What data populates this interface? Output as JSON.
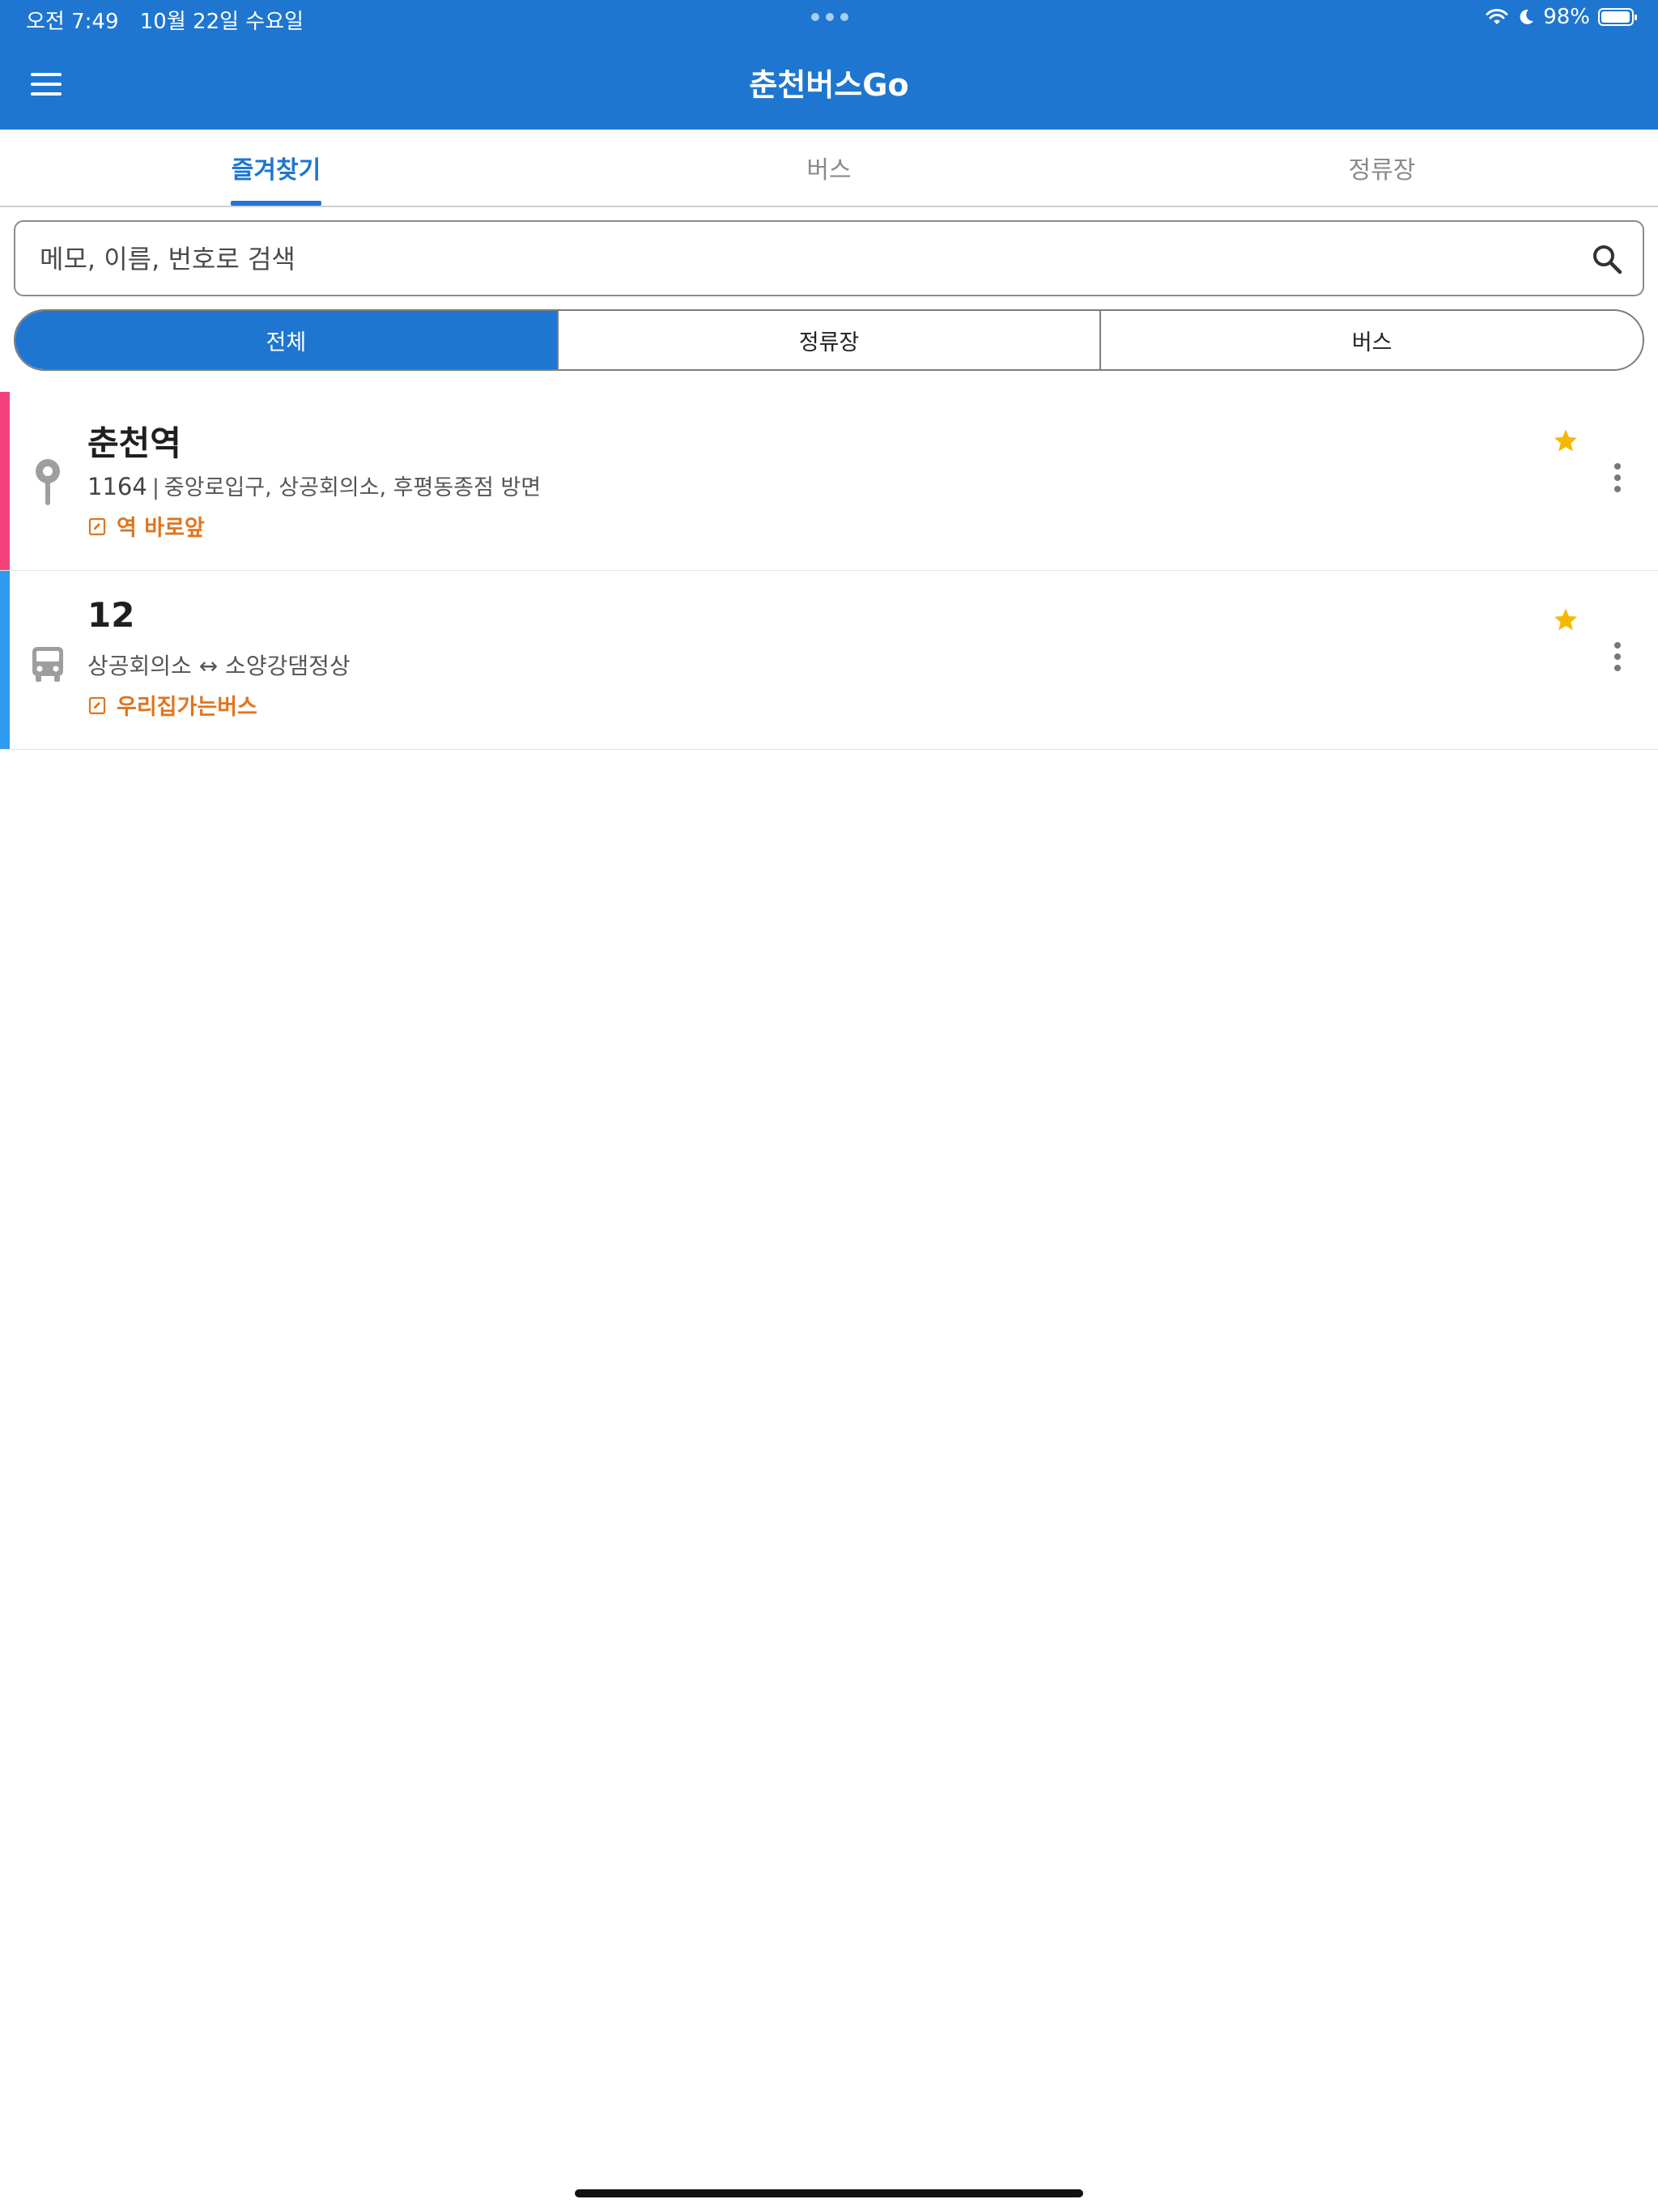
{
  "status_bar": {
    "time": "오전 7:49",
    "date": "10월 22일 수요일",
    "battery": "98%",
    "battery_level": 0.98
  },
  "header": {
    "title": "춘천버스Go"
  },
  "tabs": [
    {
      "label": "즐겨찾기",
      "active": true
    },
    {
      "label": "버스",
      "active": false
    },
    {
      "label": "정류장",
      "active": false
    }
  ],
  "search": {
    "placeholder": "메모, 이름, 번호로 검색"
  },
  "filter": [
    {
      "label": "전체",
      "active": true
    },
    {
      "label": "정류장",
      "active": false
    },
    {
      "label": "버스",
      "active": false
    }
  ],
  "favorites": [
    {
      "type": "stop",
      "icon": "bus-stop-icon",
      "accent_color": "#f2417a",
      "title": "춘천역",
      "number": "1164",
      "separator": "|",
      "direction": "중앙로입구, 상공회의소, 후평동종점 방면",
      "memo": "역 바로앞"
    },
    {
      "type": "bus",
      "icon": "bus-icon",
      "accent_color": "#2f9bf0",
      "title": "12",
      "route": "상공회의소 ↔ 소양강댐정상",
      "memo": "우리집가는버스"
    }
  ],
  "colors": {
    "primary": "#1e76d0",
    "memo": "#e0751e",
    "star": "#f5b800"
  }
}
